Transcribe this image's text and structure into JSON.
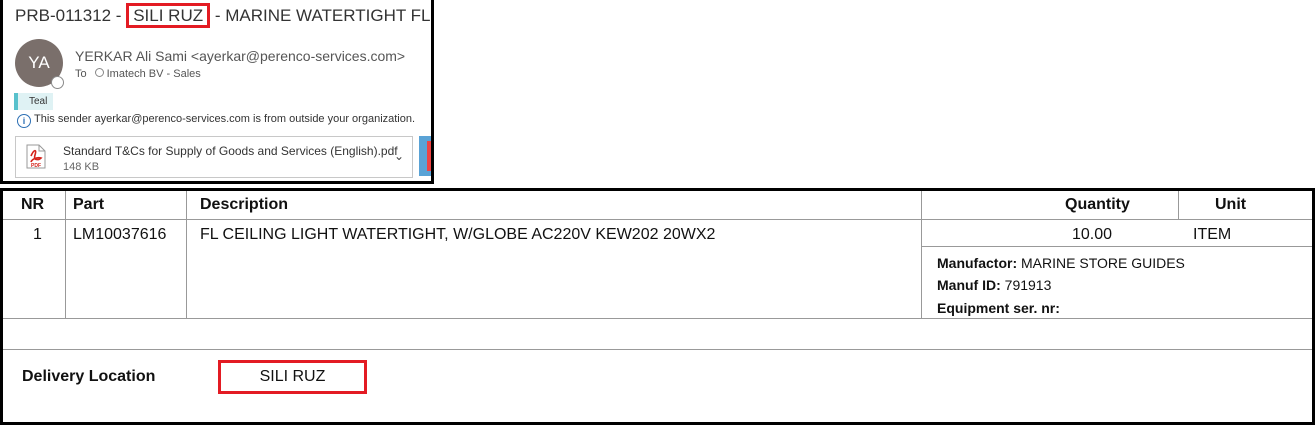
{
  "email": {
    "subject_prefix": "PRB-011312 - ",
    "subject_highlight": "SILI RUZ",
    "subject_suffix": " - MARINE WATERTIGHT FL",
    "avatar_initials": "YA",
    "sender": "YERKAR Ali Sami <ayerkar@perenco-services.com>",
    "to_label": "To",
    "to_recipient": "Imatech BV - Sales",
    "category_tag": "Teal",
    "external_notice": "This sender ayerkar@perenco-services.com is from outside your organization.",
    "attachment": {
      "name": "Standard T&Cs for Supply of Goods and Services (English).pdf",
      "size": "148 KB",
      "icon_label": "PDF"
    }
  },
  "table": {
    "headers": {
      "nr": "NR",
      "part": "Part",
      "description": "Description",
      "quantity": "Quantity",
      "unit": "Unit"
    },
    "rows": [
      {
        "nr": "1",
        "part": "LM10037616",
        "description": "FL CEILING LIGHT WATERTIGHT, W/GLOBE AC220V KEW202 20WX2",
        "quantity": "10.00",
        "unit": "ITEM",
        "manufactor_label": "Manufactor:",
        "manufactor_value": "MARINE STORE GUIDES",
        "manuf_id_label": "Manuf ID:",
        "manuf_id_value": "791913",
        "equipment_label": "Equipment ser. nr:",
        "equipment_value": ""
      }
    ]
  },
  "delivery": {
    "label": "Delivery Location",
    "value": "SILI RUZ"
  },
  "colors": {
    "highlight_red": "#e31b23",
    "tag_teal": "#58c1cc",
    "avatar_bg": "#7a6f6b"
  }
}
